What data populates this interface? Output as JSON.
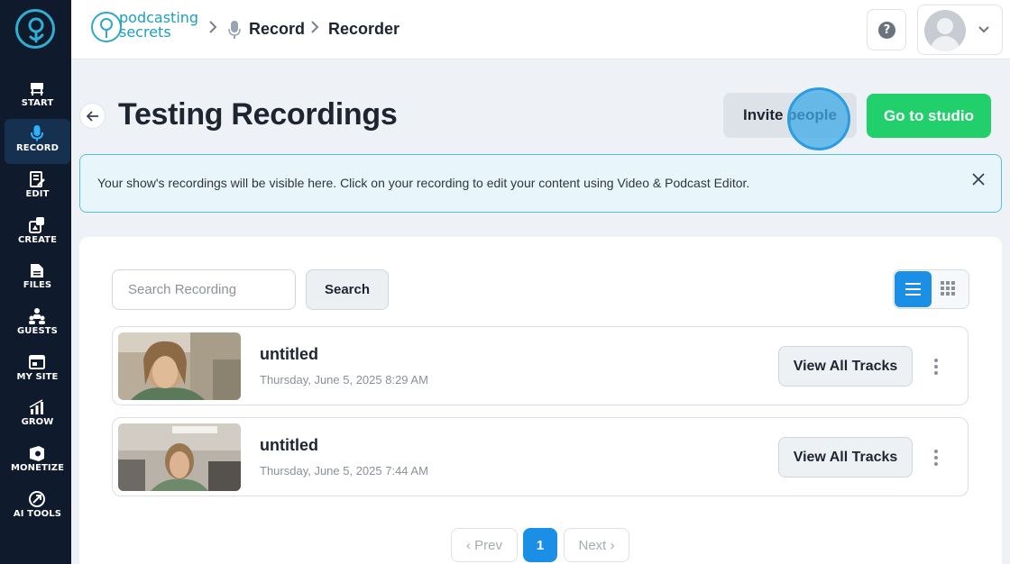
{
  "sidebar": {
    "items": [
      {
        "label": "START",
        "icon": "start-icon"
      },
      {
        "label": "RECORD",
        "icon": "microphone-icon",
        "active": true
      },
      {
        "label": "EDIT",
        "icon": "edit-icon"
      },
      {
        "label": "CREATE",
        "icon": "create-icon"
      },
      {
        "label": "FILES",
        "icon": "files-icon"
      },
      {
        "label": "GUESTS",
        "icon": "guests-icon"
      },
      {
        "label": "MY SITE",
        "icon": "site-icon"
      },
      {
        "label": "GROW",
        "icon": "grow-icon"
      },
      {
        "label": "MONETIZE",
        "icon": "monetize-icon"
      },
      {
        "label": "AI TOOLS",
        "icon": "ai-tools-icon"
      }
    ]
  },
  "header": {
    "brand_line1": "podcasting",
    "brand_line2": "secrets",
    "breadcrumb": [
      "Record",
      "Recorder"
    ],
    "help_icon": "question-icon"
  },
  "page": {
    "title": "Testing Recordings",
    "invite_label": "Invite people",
    "studio_label": "Go to studio"
  },
  "notice": {
    "text": "Your show's recordings will be visible here. Click on your recording to edit your content using Video & Podcast Editor."
  },
  "search": {
    "placeholder": "Search Recording",
    "button_label": "Search"
  },
  "recordings": [
    {
      "title": "untitled",
      "date": "Thursday, June 5, 2025 8:29 AM",
      "action": "View All Tracks"
    },
    {
      "title": "untitled",
      "date": "Thursday, June 5, 2025 7:44 AM",
      "action": "View All Tracks"
    }
  ],
  "pagination": {
    "prev": "Prev",
    "current": "1",
    "next": "Next"
  },
  "colors": {
    "sidebar_bg": "#0f1a2c",
    "accent_blue": "#1b8fe6",
    "studio_green": "#22d06b",
    "notice_border": "#58c0dc"
  }
}
